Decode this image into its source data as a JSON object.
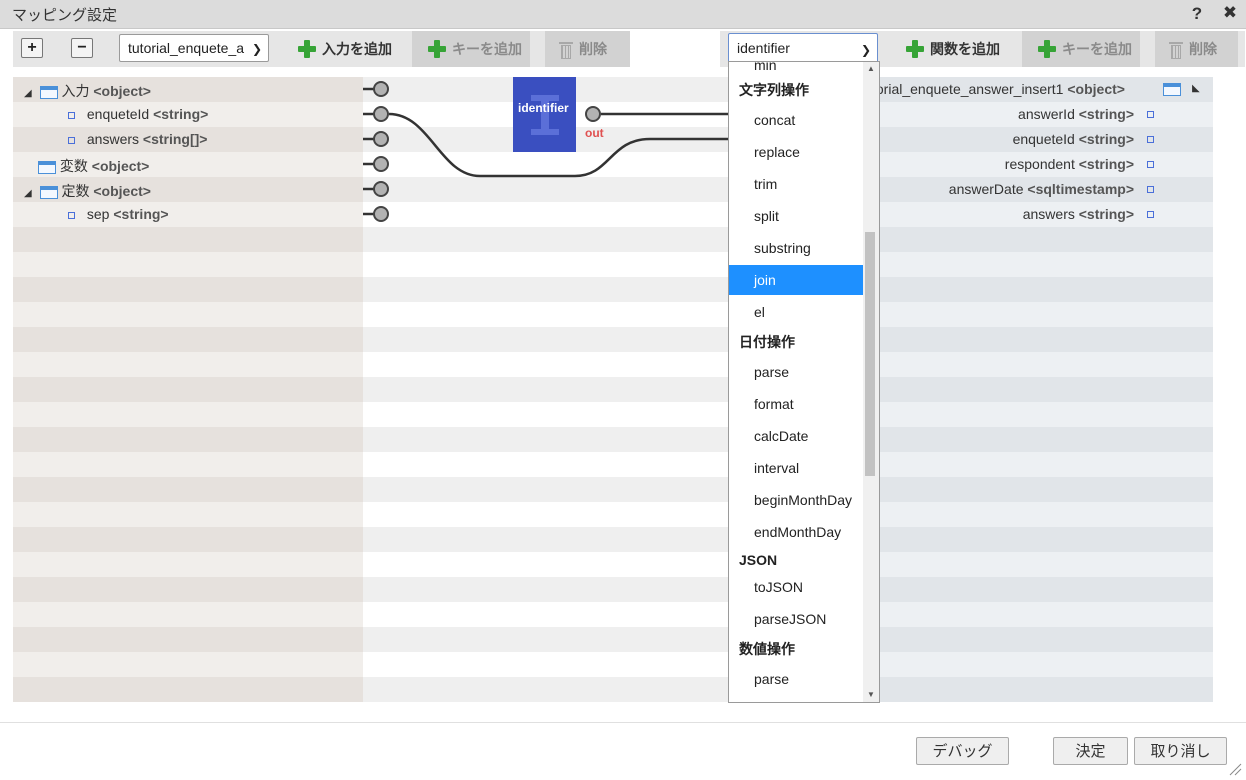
{
  "window": {
    "title": "マッピング設定",
    "help": "?",
    "close": "✖"
  },
  "toolbar_left": {
    "expand": "+",
    "collapse": "−",
    "input_select_value": "tutorial_enquete_a",
    "add_input": "入力を追加",
    "add_key": "キーを追加",
    "delete": "削除"
  },
  "toolbar_right": {
    "function_select_value": "identifier",
    "add_function": "関数を追加",
    "add_key": "キーを追加",
    "delete": "削除"
  },
  "input_tree": [
    {
      "label": "入力",
      "type": "<object>",
      "kind": "object",
      "expanded": true
    },
    {
      "label": "enqueteId",
      "type": "<string>",
      "kind": "field"
    },
    {
      "label": "answers",
      "type": "<string[]>",
      "kind": "field"
    },
    {
      "label": "変数",
      "type": "<object>",
      "kind": "object",
      "expanded": false
    },
    {
      "label": "定数",
      "type": "<object>",
      "kind": "object",
      "expanded": true
    },
    {
      "label": "sep",
      "type": "<string>",
      "kind": "field"
    }
  ],
  "output_tree": [
    {
      "label": "torial_enquete_answer_insert1",
      "type": "<object>",
      "kind": "object"
    },
    {
      "label": "answerId",
      "type": "<string>",
      "kind": "field"
    },
    {
      "label": "enqueteId",
      "type": "<string>",
      "kind": "field"
    },
    {
      "label": "respondent",
      "type": "<string>",
      "kind": "field"
    },
    {
      "label": "answerDate",
      "type": "<sqltimestamp>",
      "kind": "field"
    },
    {
      "label": "answers",
      "type": "<string>",
      "kind": "field"
    }
  ],
  "function_node": {
    "name": "identifier",
    "port_label": "out",
    "color": "#3a4fc0"
  },
  "dropdown": {
    "clipped_top": "min",
    "groups": [
      {
        "label": "文字列操作",
        "items": [
          "concat",
          "replace",
          "trim",
          "split",
          "substring",
          "join",
          "el"
        ]
      },
      {
        "label": "日付操作",
        "items": [
          "parse",
          "format",
          "calcDate",
          "interval",
          "beginMonthDay",
          "endMonthDay"
        ]
      },
      {
        "label": "JSON",
        "items": [
          "toJSON",
          "parseJSON"
        ]
      },
      {
        "label": "数値操作",
        "items": [
          "parse"
        ]
      }
    ],
    "selected": "join"
  },
  "footer": {
    "debug": "デバッグ",
    "ok": "決定",
    "cancel": "取り消し"
  },
  "colors": {
    "accent": "#1e90ff",
    "add_icon": "#37a437",
    "node_blue": "#3a4fc0",
    "out_label": "#e05050"
  }
}
